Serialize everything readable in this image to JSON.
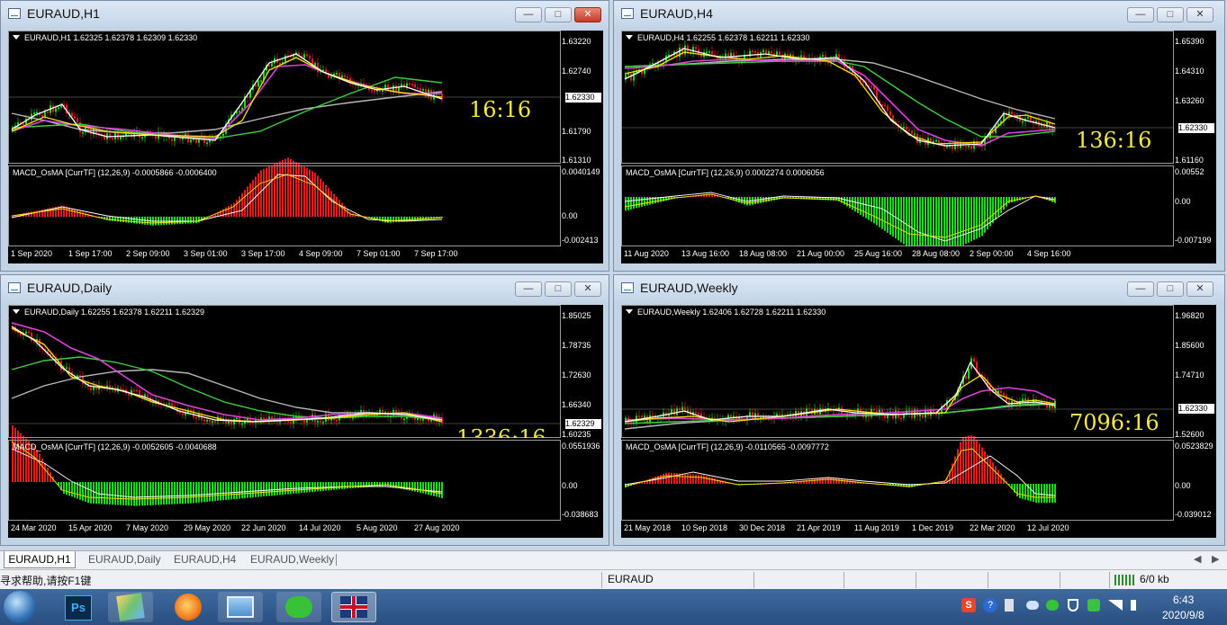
{
  "windows": [
    {
      "key": "h1",
      "title": "EURAUD,H1",
      "ohlc": "EURAUD,H1  1.62325 1.62378 1.62309 1.62330",
      "macd": "MACD_OsMA [CurrTF] (12,26,9) -0.0005866 -0.0006400",
      "prices": [
        "1.63220",
        "1.62740",
        "1.62330",
        "1.61790",
        "1.61310"
      ],
      "current": "1.62330",
      "macd_scale": [
        "0.0040149",
        "0.00",
        "-0.002413"
      ],
      "dates": [
        "1 Sep 2020",
        "1 Sep 17:00",
        "2 Sep 09:00",
        "3 Sep 01:00",
        "3 Sep 17:00",
        "4 Sep 09:00",
        "7 Sep 01:00",
        "7 Sep 17:00"
      ],
      "timer": "16:16"
    },
    {
      "key": "h4",
      "title": "EURAUD,H4",
      "ohlc": "EURAUD,H4  1.62255 1.62378 1.62211 1.62330",
      "macd": "MACD_OsMA [CurrTF] (12,26,9) 0.0002274 0.0006056",
      "prices": [
        "1.65390",
        "1.64310",
        "1.63260",
        "1.62330",
        "1.61160"
      ],
      "current": "1.62330",
      "macd_scale": [
        "0.00552",
        "0.00",
        "-0.007199"
      ],
      "dates": [
        "11 Aug 2020",
        "13 Aug 16:00",
        "18 Aug 08:00",
        "21 Aug 00:00",
        "25 Aug 16:00",
        "28 Aug 08:00",
        "2 Sep 00:00",
        "4 Sep 16:00"
      ],
      "timer": "136:16"
    },
    {
      "key": "d1",
      "title": "EURAUD,Daily",
      "ohlc": "EURAUD,Daily  1.62255 1.62378 1.62211 1.62329",
      "macd": "MACD_OsMA [CurrTF] (12,26,9) -0.0052605 -0.0040688",
      "prices": [
        "1.85025",
        "1.78735",
        "1.72630",
        "1.66340",
        "1.62329",
        "1.60235"
      ],
      "current": "1.62329",
      "macd_scale": [
        "0.0551936",
        "0.00",
        "-0.038683"
      ],
      "dates": [
        "24 Mar 2020",
        "15 Apr 2020",
        "7 May 2020",
        "29 May 2020",
        "22 Jun 2020",
        "14 Jul 2020",
        "5 Aug 2020",
        "27 Aug 2020"
      ],
      "timer": "1336:16"
    },
    {
      "key": "w1",
      "title": "EURAUD,Weekly",
      "ohlc": "EURAUD,Weekly  1.62406 1.62728 1.62211 1.62330",
      "macd": "MACD_OsMA [CurrTF] (12,26,9) -0.0110565 -0.0097772",
      "prices": [
        "1.96820",
        "1.85600",
        "1.74710",
        "1.62330",
        "1.52600"
      ],
      "current": "1.62330",
      "macd_scale": [
        "0.0523829",
        "0.00",
        "-0.039012"
      ],
      "dates": [
        "21 May 2018",
        "10 Sep 2018",
        "30 Dec 2018",
        "21 Apr 2019",
        "11 Aug 2019",
        "1 Dec 2019",
        "22 Mar 2020",
        "12 Jul 2020"
      ],
      "timer": "7096:16"
    }
  ],
  "tabs": [
    "EURAUD,H1",
    "EURAUD,Daily",
    "EURAUD,H4",
    "EURAUD,Weekly"
  ],
  "status": {
    "help": "寻求帮助,请按F1键",
    "symbol": "EURAUD",
    "traffic": "6/0 kb"
  },
  "clock": {
    "time": "6:43",
    "date": "2020/9/8"
  },
  "colors": {
    "bull": "#1fd61f",
    "bear": "#e01c1c",
    "ma_white": "#ffffff",
    "ma_yellow": "#f5e400",
    "ma_magenta": "#e040e0",
    "ma_green": "#3ccf3c",
    "ma_gray": "#b8b8b8",
    "timer": "#f4e842"
  },
  "taskbar_icons": [
    "start-orb-icon",
    "photoshop-icon",
    "maps-app-icon",
    "firefox-icon",
    "photo-viewer-icon",
    "wechat-icon",
    "flag-app-icon"
  ]
}
